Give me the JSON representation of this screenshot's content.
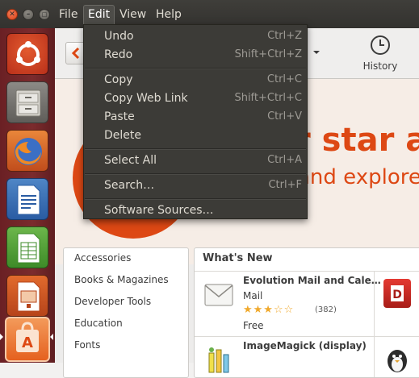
{
  "window": {
    "close_icon": "close-icon",
    "minimize_icon": "minimize-icon",
    "maximize_icon": "maximize-icon"
  },
  "menubar": {
    "items": [
      {
        "label": "File"
      },
      {
        "label": "Edit"
      },
      {
        "label": "View"
      },
      {
        "label": "Help"
      }
    ],
    "active": "Edit"
  },
  "edit_menu": {
    "items": [
      {
        "label": "Undo",
        "accel": "Ctrl+Z"
      },
      {
        "label": "Redo",
        "accel": "Shift+Ctrl+Z"
      },
      {
        "label": "Copy",
        "accel": "Ctrl+C"
      },
      {
        "label": "Copy Web Link",
        "accel": "Shift+Ctrl+C"
      },
      {
        "label": "Paste",
        "accel": "Ctrl+V"
      },
      {
        "label": "Delete",
        "accel": ""
      },
      {
        "label": "Select All",
        "accel": "Ctrl+A"
      },
      {
        "label": "Search…",
        "accel": "Ctrl+F"
      },
      {
        "label": "Software Sources…",
        "accel": ""
      }
    ]
  },
  "launcher": {
    "items": [
      {
        "name": "ubuntu-dash-icon"
      },
      {
        "name": "file-manager-icon"
      },
      {
        "name": "firefox-icon"
      },
      {
        "name": "libreoffice-writer-icon"
      },
      {
        "name": "libreoffice-calc-icon"
      },
      {
        "name": "libreoffice-impress-icon"
      },
      {
        "name": "software-center-icon"
      }
    ]
  },
  "toolbar": {
    "history_label": "History",
    "history_icon": "clock-icon"
  },
  "banner": {
    "line1": "r star a",
    "line2": "and explore"
  },
  "categories": {
    "items": [
      "Accessories",
      "Books & Magazines",
      "Developer Tools",
      "Education",
      "Fonts"
    ]
  },
  "whats_new": {
    "title": "What's New",
    "apps": [
      {
        "name": "Evolution Mail and Cale…",
        "subtitle": "Mail",
        "rating": 3,
        "reviews": "(382)",
        "price": "Free"
      },
      {
        "name": "ImageMagick (display)"
      }
    ]
  },
  "colors": {
    "accent": "#dd4814",
    "menu_bg": "#3c3b37",
    "launcher_bg": "#6f2427",
    "star": "#f0a92c"
  }
}
